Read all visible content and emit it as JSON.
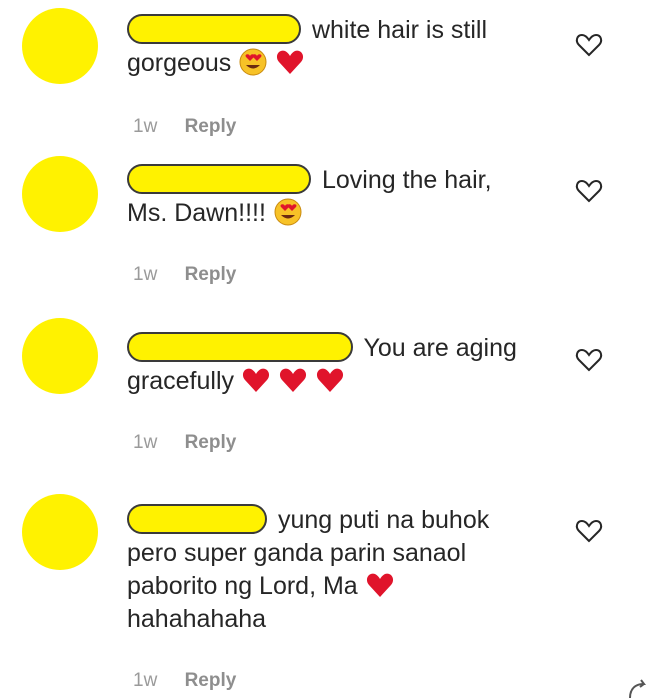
{
  "comments": [
    {
      "text_before": "white hair is still",
      "text_after": "gorgeous",
      "emojis": [
        "heart-eyes-emoji",
        "red-heart-emoji"
      ],
      "time": "1w",
      "reply": "Reply"
    },
    {
      "text_before": "Loving the hair,",
      "text_after": "Ms. Dawn!!!!",
      "emojis": [
        "heart-eyes-emoji"
      ],
      "time": "1w",
      "reply": "Reply"
    },
    {
      "text_before": "You are aging",
      "text_after": "gracefully",
      "emojis": [
        "red-heart-emoji",
        "red-heart-emoji",
        "red-heart-emoji"
      ],
      "time": "1w",
      "reply": "Reply"
    },
    {
      "text_before": "yung puti na buhok",
      "text_after": "pero super ganda parin sanaol paborito ng Lord, Ma",
      "text_tail": "hahahahaha",
      "emojis": [
        "red-heart-emoji"
      ],
      "time": "1w",
      "reply": "Reply"
    }
  ],
  "colors": {
    "redaction": "#fff200",
    "heart": "#e0142b",
    "meta_text": "#8e8e8e"
  },
  "icons": {
    "like": "heart-outline-icon",
    "share": "curved-arrow-icon"
  }
}
